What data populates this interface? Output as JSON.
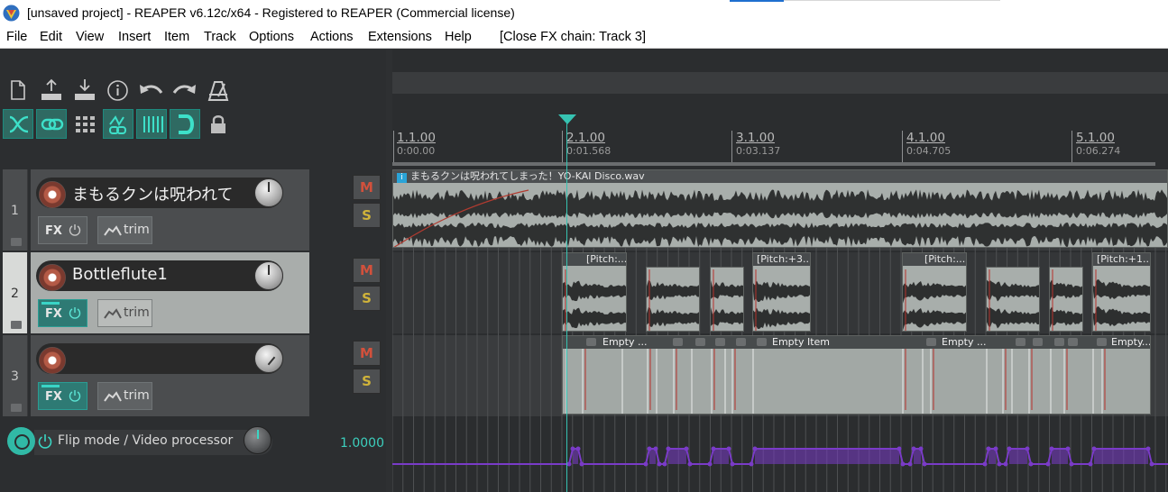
{
  "window": {
    "title": "[unsaved project] - REAPER v6.12c/x64 - Registered to REAPER (Commercial license)"
  },
  "menu": {
    "items": [
      "File",
      "Edit",
      "View",
      "Insert",
      "Item",
      "Track",
      "Options",
      "Actions",
      "Extensions",
      "Help"
    ],
    "action_hint": "[Close FX chain: Track 3]"
  },
  "toolbar": {
    "row1_icons": [
      "new-project-icon",
      "save-upload-icon",
      "load-download-icon",
      "info-icon",
      "undo-icon",
      "redo-icon",
      "metronome-icon"
    ],
    "row2_toggles": [
      {
        "name": "ripple-edit-icon",
        "on": true
      },
      {
        "name": "link-icon",
        "on": true
      },
      {
        "name": "grid-icon",
        "on": false
      },
      {
        "name": "envelope-link-icon",
        "on": true
      },
      {
        "name": "grid-lines-icon",
        "on": true
      },
      {
        "name": "snap-magnet-icon",
        "on": true
      },
      {
        "name": "lock-icon",
        "on": false
      }
    ]
  },
  "tracks": [
    {
      "number": "1",
      "name": "まもるクンは呪われて",
      "fx_label": "FX",
      "trim_label": "trim",
      "mute": "M",
      "solo": "S",
      "selected": false
    },
    {
      "number": "2",
      "name": "Bottleflute1",
      "fx_label": "FX",
      "trim_label": "trim",
      "mute": "M",
      "solo": "S",
      "selected": true
    },
    {
      "number": "3",
      "name": "",
      "fx_label": "FX",
      "trim_label": "trim",
      "mute": "M",
      "solo": "S",
      "selected": false
    }
  ],
  "master": {
    "video_processor_label": "Flip mode / Video processor",
    "value": "1.0000"
  },
  "ruler": {
    "bars": [
      {
        "label": "1.1.00",
        "time": "0:00.00"
      },
      {
        "label": "2.1.00",
        "time": "0:01.568"
      },
      {
        "label": "3.1.00",
        "time": "0:03.137"
      },
      {
        "label": "4.1.00",
        "time": "0:04.705"
      },
      {
        "label": "5.1.00",
        "time": "0:06.274"
      }
    ]
  },
  "items": {
    "track1_item_title": "まもるクンは呪われてしまった！YO-KAI Disco.wav",
    "track2_labels": [
      "[Pitch:...",
      "[Pitch:+3....",
      "[Pitch:...",
      "[Pitch:+1..."
    ],
    "track3_labels": [
      "Empty ...",
      "Empty Item",
      "Empty ...",
      "Empty..."
    ]
  },
  "colors": {
    "accent": "#31b9a6",
    "mute": "#d2513c",
    "solo": "#d0b33a",
    "automation": "#7a3bc8"
  }
}
